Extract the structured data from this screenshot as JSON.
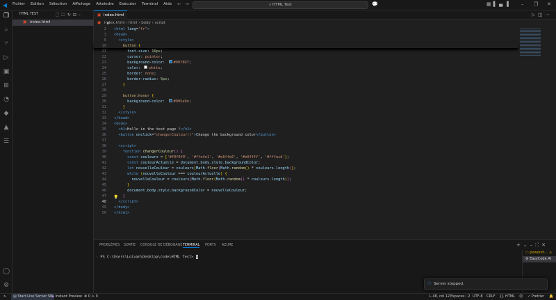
{
  "menu": [
    "Fichier",
    "Edition",
    "Sélection",
    "Affichage",
    "Atteindre",
    "Exécuter",
    "Terminal",
    "Aide"
  ],
  "search": "HTML Test",
  "explorer": {
    "title": "HTML TEST",
    "file": "index.html"
  },
  "tab": {
    "label": "index.html",
    "close": "×"
  },
  "breadcrumb": [
    "index.html",
    "html",
    "body",
    "script"
  ],
  "code": [
    {
      "n": "2",
      "s": 1,
      "t": [
        [
          "tag",
          "<html "
        ],
        [
          "attr",
          "lang"
        ],
        [
          "txt",
          "="
        ],
        [
          "str",
          "\"fr\""
        ],
        [
          "tag",
          ">"
        ]
      ]
    },
    {
      "n": "3",
      "s": 1,
      "t": [
        [
          "tag",
          "<head>"
        ]
      ]
    },
    {
      "n": "6",
      "s": 1,
      "t": [
        [
          "tag",
          "  <style>"
        ]
      ]
    },
    {
      "n": "19",
      "s": 1,
      "t": [
        [
          "sel",
          "    button "
        ],
        [
          "brk",
          "{"
        ]
      ]
    },
    {
      "n": "21",
      "t": [
        [
          "attr",
          "      font-size"
        ],
        [
          "txt",
          ": "
        ],
        [
          "num",
          "16px"
        ],
        [
          "txt",
          ";"
        ]
      ]
    },
    {
      "n": "22",
      "t": [
        [
          "attr",
          "      cursor"
        ],
        [
          "txt",
          ": "
        ],
        [
          "str",
          "pointer"
        ],
        [
          "txt",
          ";"
        ]
      ]
    },
    {
      "n": "23",
      "t": [
        [
          "attr",
          "      background-color"
        ],
        [
          "txt",
          ": "
        ],
        [
          "sw",
          "#0078D7"
        ],
        [
          "str",
          "#0078D7"
        ],
        [
          "txt",
          ";"
        ]
      ]
    },
    {
      "n": "24",
      "t": [
        [
          "attr",
          "      color"
        ],
        [
          "txt",
          ": "
        ],
        [
          "sw",
          "#ffffff"
        ],
        [
          "str",
          "white"
        ],
        [
          "txt",
          ";"
        ]
      ]
    },
    {
      "n": "25",
      "t": [
        [
          "attr",
          "      border"
        ],
        [
          "txt",
          ": "
        ],
        [
          "str",
          "none"
        ],
        [
          "txt",
          ";"
        ]
      ]
    },
    {
      "n": "26",
      "t": [
        [
          "attr",
          "      border-radius"
        ],
        [
          "txt",
          ": "
        ],
        [
          "num",
          "5px"
        ],
        [
          "txt",
          ";"
        ]
      ]
    },
    {
      "n": "27",
      "t": [
        [
          "brk",
          "    }"
        ]
      ]
    },
    {
      "n": "28",
      "t": []
    },
    {
      "n": "29",
      "t": [
        [
          "sel",
          "    button:hover "
        ],
        [
          "brk",
          "{"
        ]
      ]
    },
    {
      "n": "30",
      "t": [
        [
          "attr",
          "      background-color"
        ],
        [
          "txt",
          ": "
        ],
        [
          "sw",
          "#005a9e"
        ],
        [
          "str",
          "#005a9e"
        ],
        [
          "txt",
          ";"
        ]
      ]
    },
    {
      "n": "31",
      "t": [
        [
          "brk",
          "    }"
        ]
      ]
    },
    {
      "n": "32",
      "t": [
        [
          "tag",
          "  </style>"
        ]
      ]
    },
    {
      "n": "33",
      "t": [
        [
          "tag",
          "</head>"
        ]
      ]
    },
    {
      "n": "34",
      "t": [
        [
          "tag",
          "<body>"
        ]
      ]
    },
    {
      "n": "35",
      "t": [
        [
          "tag",
          "  <h1>"
        ],
        [
          "txt",
          "Hello in the test page !"
        ],
        [
          "tag",
          "</h1>"
        ]
      ]
    },
    {
      "n": "36",
      "t": [
        [
          "tag",
          "  <button "
        ],
        [
          "attr",
          "onclick"
        ],
        [
          "txt",
          "="
        ],
        [
          "str",
          "\"changerCouleur()\""
        ],
        [
          "tag",
          ">"
        ],
        [
          "txt",
          "Change the background color"
        ],
        [
          "tag",
          "</button>"
        ]
      ]
    },
    {
      "n": "37",
      "t": []
    },
    {
      "n": "38",
      "t": [
        [
          "tag",
          "  <script>"
        ]
      ]
    },
    {
      "n": "39",
      "t": [
        [
          "kw",
          "    function "
        ],
        [
          "fn",
          "changerCouleur"
        ],
        [
          "brk2",
          "() "
        ],
        [
          "brk2",
          "{"
        ]
      ]
    },
    {
      "n": "40",
      "t": [
        [
          "kw",
          "      const "
        ],
        [
          "var",
          "couleurs"
        ],
        [
          "txt",
          " = "
        ],
        [
          "brk",
          "["
        ],
        [
          "str",
          "'#f0f0f0'"
        ],
        [
          "txt",
          ", "
        ],
        [
          "str",
          "'#ffe4e1'"
        ],
        [
          "txt",
          ", "
        ],
        [
          "str",
          "'#e6ffe6'"
        ],
        [
          "txt",
          ", "
        ],
        [
          "str",
          "'#e0ffff'"
        ],
        [
          "txt",
          ", "
        ],
        [
          "str",
          "'#fffacd'"
        ],
        [
          "brk",
          "]"
        ],
        [
          "txt",
          ";"
        ]
      ]
    },
    {
      "n": "41",
      "t": [
        [
          "kw",
          "      const "
        ],
        [
          "var",
          "couleurActuelle"
        ],
        [
          "txt",
          " = "
        ],
        [
          "var",
          "document"
        ],
        [
          "txt",
          "."
        ],
        [
          "var",
          "body"
        ],
        [
          "txt",
          "."
        ],
        [
          "var",
          "style"
        ],
        [
          "txt",
          "."
        ],
        [
          "var",
          "backgroundColor"
        ],
        [
          "txt",
          ";"
        ]
      ]
    },
    {
      "n": "42",
      "t": [
        [
          "kw",
          "      let "
        ],
        [
          "var",
          "nouvelleCouleur"
        ],
        [
          "txt",
          " = "
        ],
        [
          "var",
          "couleurs"
        ],
        [
          "brk",
          "["
        ],
        [
          "var",
          "Math"
        ],
        [
          "txt",
          "."
        ],
        [
          "fn",
          "floor"
        ],
        [
          "brk2",
          "("
        ],
        [
          "var",
          "Math"
        ],
        [
          "txt",
          "."
        ],
        [
          "fn",
          "random"
        ],
        [
          "brk",
          "()"
        ],
        [
          "txt",
          " * "
        ],
        [
          "var",
          "couleurs"
        ],
        [
          "txt",
          "."
        ],
        [
          "var",
          "length"
        ],
        [
          "brk2",
          ")"
        ],
        [
          "brk",
          "]"
        ],
        [
          "txt",
          ";"
        ]
      ]
    },
    {
      "n": "43",
      "t": [
        [
          "kw",
          "      while "
        ],
        [
          "brk",
          "("
        ],
        [
          "var",
          "nouvelleCouleur"
        ],
        [
          "txt",
          " === "
        ],
        [
          "var",
          "couleurActuelle"
        ],
        [
          "brk",
          ") {"
        ]
      ]
    },
    {
      "n": "44",
      "t": [
        [
          "var",
          "        nouvelleCouleur"
        ],
        [
          "txt",
          " = "
        ],
        [
          "var",
          "couleurs"
        ],
        [
          "brk2",
          "["
        ],
        [
          "var",
          "Math"
        ],
        [
          "txt",
          "."
        ],
        [
          "fn",
          "floor"
        ],
        [
          "brk",
          "("
        ],
        [
          "var",
          "Math"
        ],
        [
          "txt",
          "."
        ],
        [
          "fn",
          "random"
        ],
        [
          "brk2",
          "()"
        ],
        [
          "txt",
          " * "
        ],
        [
          "var",
          "couleurs"
        ],
        [
          "txt",
          "."
        ],
        [
          "var",
          "length"
        ],
        [
          "brk",
          ")"
        ],
        [
          "brk2",
          "]"
        ],
        [
          "txt",
          ";"
        ]
      ]
    },
    {
      "n": "45",
      "t": [
        [
          "brk",
          "      }"
        ]
      ]
    },
    {
      "n": "46",
      "t": [
        [
          "var",
          "      document"
        ],
        [
          "txt",
          "."
        ],
        [
          "var",
          "body"
        ],
        [
          "txt",
          "."
        ],
        [
          "var",
          "style"
        ],
        [
          "txt",
          "."
        ],
        [
          "var",
          "backgroundColor"
        ],
        [
          "txt",
          " = "
        ],
        [
          "var",
          "nouvelleCouleur"
        ],
        [
          "txt",
          ";"
        ]
      ]
    },
    {
      "n": "47",
      "t": [
        [
          "brk2",
          "    }"
        ]
      ]
    },
    {
      "n": "48",
      "c": 1,
      "t": [
        [
          "tag",
          "  </script>"
        ]
      ]
    },
    {
      "n": "49",
      "t": [
        [
          "tag",
          "</body>"
        ]
      ]
    },
    {
      "n": "50",
      "t": [
        [
          "tag",
          "</html>"
        ]
      ]
    }
  ],
  "panel": {
    "tabs": [
      "PROBLÈMES",
      "SORTIE",
      "CONSOLE DE DÉBOGAGE",
      "TERMINAL",
      "PORTS",
      "AZURE"
    ],
    "active": 3,
    "prompt": "PS C:\\Users\\Loïvan\\Desktop\\code\\HTML Test> ",
    "terminals": [
      "powersh...",
      "EasyCode AI"
    ]
  },
  "toast": "Server stopped.",
  "status": {
    "live_server": "Start Live Server SE",
    "preview": "Instant Preview",
    "errors": "0",
    "warnings": "0",
    "position": "L 48, col 12",
    "spaces": "Espaces : 2",
    "encoding": "UTF-8",
    "eol": "CRLF",
    "language": "HTML",
    "prettier": "Prettier"
  }
}
